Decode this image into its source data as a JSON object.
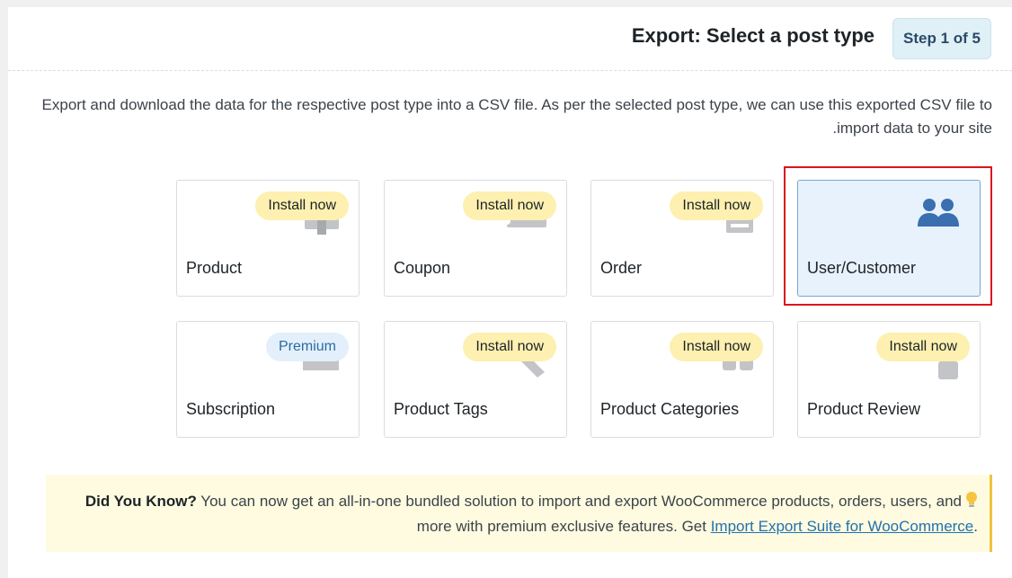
{
  "header": {
    "title": "Export: Select a post type",
    "step": "Step 1 of 5"
  },
  "intro": {
    "text": "Export and download the data for the respective post type into a CSV file. As per the selected post type, we can use this exported CSV file to import data to your site."
  },
  "cards": [
    {
      "label": "Product",
      "badge": "Install now",
      "icon": "product-icon"
    },
    {
      "label": "Coupon",
      "badge": "Install now",
      "icon": "coupon-icon"
    },
    {
      "label": "Order",
      "badge": "Install now",
      "icon": "order-icon"
    },
    {
      "label": "User/Customer",
      "badge": "",
      "icon": "users-icon",
      "selected": true
    },
    {
      "label": "Subscription",
      "badge": "Premium",
      "icon": "subscription-icon"
    },
    {
      "label": "Product Tags",
      "badge": "Install now",
      "icon": "tag-icon"
    },
    {
      "label": "Product Categories",
      "badge": "Install now",
      "icon": "categories-icon"
    },
    {
      "label": "Product Review",
      "badge": "Install now",
      "icon": "review-icon"
    }
  ],
  "tip": {
    "title": "Did You Know?",
    "text": " You can now get an all-in-one bundled solution to import and export WooCommerce products, orders, users, and more with premium exclusive features. Get ",
    "link": "Import Export Suite for WooCommerce",
    "end": ".",
    "icon": "lightbulb-icon"
  },
  "colors": {
    "accent": "#2271b1",
    "selected_card": "#e8f2fc",
    "install_badge": "#fdf0b0",
    "premium_badge": "#e3f0fb",
    "highlight": "#d9161c",
    "users_icon": "#3a6fb0"
  }
}
